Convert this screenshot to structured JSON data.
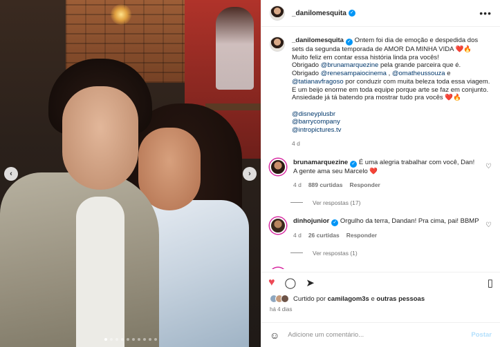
{
  "post": {
    "username": "_danilomesquita",
    "caption": {
      "author": "_danilomesquita",
      "p1": "Ontem foi dia de emoção e despedida dos sets da segunda temporada de AMOR DA MINHA VIDA ",
      "p1_emoji": "❤️🔥",
      "p2": "Muito feliz em contar essa história linda pra vocês!",
      "p3a": "Obrigado ",
      "p3_tag": "@brunamarquezine",
      "p3b": " pela grande parceira que é.",
      "p4a": "Obrigado ",
      "p4_tag1": "@renesampaiocinema",
      "p4_mid": " , ",
      "p4_tag2": "@omatheussouza",
      "p4b": " e",
      "p5_tag": "@tatianavfragoso",
      "p5b": " por conduzir com muita beleza toda essa viagem.",
      "p6": "E um beijo enorme em toda equipe porque arte se faz em conjunto.",
      "p7": "Ansiedade já tá batendo pra mostrar tudo pra vocês ",
      "p7_emoji": "❤️🔥",
      "tags": [
        "@disneyplusbr",
        "@barrycompany",
        "@intropictures.tv"
      ],
      "time": "4 d"
    },
    "comments": [
      {
        "user": "brunamarquezine",
        "text": "É uma alegria trabalhar com você, Dan! A gente ama seu Marcelo ",
        "emoji": "❤️",
        "time": "4 d",
        "likes": "889 curtidas",
        "reply": "Responder",
        "view_replies": "Ver respostas (17)"
      },
      {
        "user": "dinhojunior",
        "text": "Orgulho da terra, Dandan! Pra cima, pai! BBMP",
        "emoji": "",
        "time": "4 d",
        "likes": "26 curtidas",
        "reply": "Responder",
        "view_replies": "Ver respostas (1)"
      }
    ],
    "liked_by_prefix": "Curtido por ",
    "liked_by_user": "camilagom3s",
    "liked_by_suffix_and": " e ",
    "liked_by_others": "outras pessoas",
    "posted_ago": "há 4 dias",
    "add_comment_placeholder": "Adicione um comentário...",
    "post_button": "Postar"
  },
  "carousel": {
    "total_slides": 10,
    "active_index": 0,
    "prev_glyph": "‹",
    "next_glyph": "›"
  },
  "icons": {
    "more": "•••",
    "heart": "♥",
    "comment": "◯",
    "share": "➤",
    "bookmark": "▯",
    "emoji": "☺",
    "heart_outline": "♡"
  },
  "colors": {
    "verified": "#0095f6",
    "link": "#00376b",
    "like_red": "#ed4956",
    "post_button_disabled": "#b2dffc"
  }
}
